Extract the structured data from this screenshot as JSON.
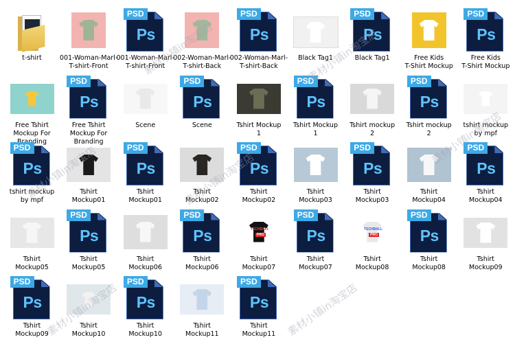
{
  "files": [
    {
      "name": "t-shirt",
      "kind": "folder"
    },
    {
      "name": "001-Woman-Marl-T-shirt-Front",
      "kind": "image",
      "thumb": "pink-shirt"
    },
    {
      "name": "001-Woman-Marl-T-shirt-Front",
      "kind": "psd"
    },
    {
      "name": "002-Woman-Marl-T-shirt-Back",
      "kind": "image",
      "thumb": "pink-shirt-back"
    },
    {
      "name": "002-Woman-Marl-T-shirt-Back",
      "kind": "psd"
    },
    {
      "name": "Black Tag1",
      "kind": "image",
      "thumb": "tag"
    },
    {
      "name": "Black Tag1",
      "kind": "psd"
    },
    {
      "name": "Free Kids\nT-Shirt Mockup",
      "kind": "image",
      "thumb": "kids"
    },
    {
      "name": "Free Kids\nT-Shirt Mockup",
      "kind": "psd"
    },
    {
      "name": "Free Tshirt\nMockup For\nBranding",
      "kind": "image",
      "thumb": "teal"
    },
    {
      "name": "Free Tshirt\nMockup For\nBranding",
      "kind": "psd"
    },
    {
      "name": "Scene",
      "kind": "image",
      "thumb": "scene"
    },
    {
      "name": "Scene",
      "kind": "psd"
    },
    {
      "name": "Tshirt Mockup\n1",
      "kind": "image",
      "thumb": "dark-stack"
    },
    {
      "name": "Tshirt Mockup\n1",
      "kind": "psd"
    },
    {
      "name": "Tshirt mockup\n2",
      "kind": "image",
      "thumb": "grey-flat"
    },
    {
      "name": "Tshirt mockup\n2",
      "kind": "psd"
    },
    {
      "name": "tshirt mockup\nby mpf",
      "kind": "image",
      "thumb": "white-red"
    },
    {
      "name": "tshirt mockup\nby mpf",
      "kind": "psd"
    },
    {
      "name": "Tshirt\nMockup01",
      "kind": "image",
      "thumb": "black-flat"
    },
    {
      "name": "Tshirt\nMockup01",
      "kind": "psd"
    },
    {
      "name": "Tshirt\nMockup02",
      "kind": "image",
      "thumb": "black-gold"
    },
    {
      "name": "Tshirt\nMockup02",
      "kind": "psd"
    },
    {
      "name": "Tshirt\nMockup03",
      "kind": "image",
      "thumb": "blue-white"
    },
    {
      "name": "Tshirt\nMockup03",
      "kind": "psd"
    },
    {
      "name": "Tshirt\nMockup04",
      "kind": "image",
      "thumb": "blue-white2"
    },
    {
      "name": "Tshirt\nMockup04",
      "kind": "psd"
    },
    {
      "name": "Tshirt\nMockup05",
      "kind": "image",
      "thumb": "crumple"
    },
    {
      "name": "Tshirt\nMockup05",
      "kind": "psd"
    },
    {
      "name": "Tshirt\nMockup06",
      "kind": "image",
      "thumb": "folded"
    },
    {
      "name": "Tshirt\nMockup06",
      "kind": "psd"
    },
    {
      "name": "Tshirt\nMockup07",
      "kind": "image",
      "thumb": "techball-black"
    },
    {
      "name": "Tshirt\nMockup07",
      "kind": "psd"
    },
    {
      "name": "Tshirt\nMockup08",
      "kind": "image",
      "thumb": "techball-white"
    },
    {
      "name": "Tshirt\nMockup08",
      "kind": "psd"
    },
    {
      "name": "Tshirt\nMockup09",
      "kind": "image",
      "thumb": "print"
    },
    {
      "name": "Tshirt\nMockup09",
      "kind": "psd"
    },
    {
      "name": "Tshirt\nMockup10",
      "kind": "image",
      "thumb": "hanging"
    },
    {
      "name": "Tshirt\nMockup10",
      "kind": "psd"
    },
    {
      "name": "Tshirt\nMockup11",
      "kind": "image",
      "thumb": "polo"
    },
    {
      "name": "Tshirt\nMockup11",
      "kind": "psd"
    }
  ],
  "psd_icon": {
    "tag": "PSD",
    "glyph": "Ps"
  },
  "overlay_text": {
    "techball": "TECHBALL",
    "pro": "PRO"
  },
  "watermark": "素材小镇in淘宝店",
  "colors": {
    "psd_bg": "#0d1d3f",
    "psd_tag": "#3da9e6",
    "ps_glyph": "#5ec3ff",
    "folder": "#e5b846"
  }
}
